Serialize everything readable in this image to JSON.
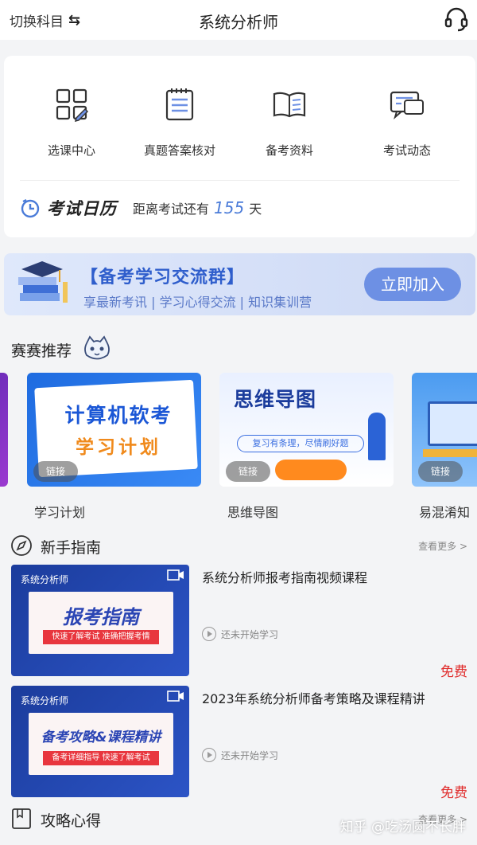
{
  "header": {
    "switch_label": "切换科目",
    "title": "系统分析师",
    "icons": [
      "switch-arrows-icon",
      "headset-icon"
    ]
  },
  "menu": {
    "items": [
      {
        "label": "选课中心",
        "icon": "course-grid-icon"
      },
      {
        "label": "真题答案核对",
        "icon": "answer-sheet-icon"
      },
      {
        "label": "备考资料",
        "icon": "open-book-icon"
      },
      {
        "label": "考试动态",
        "icon": "news-chat-icon"
      }
    ]
  },
  "calendar": {
    "title": "考试日历",
    "prefix": "距离考试还有",
    "days": "155",
    "unit": "天"
  },
  "banner": {
    "title": "【备考学习交流群】",
    "subtitle": "享最新考讯 | 学习心得交流 | 知识集训营",
    "button": "立即加入"
  },
  "recommend": {
    "title": "赛赛推荐",
    "cards": [
      {
        "label": "学习计划",
        "tag": "链接",
        "line1": "计算机软考",
        "line2": "学习计划"
      },
      {
        "label": "思维导图",
        "tag": "链接",
        "line1": "思维导图",
        "line2": "复习有条理，尽情刷好题"
      },
      {
        "label": "易混淆知",
        "tag": "链接"
      }
    ]
  },
  "guide": {
    "title": "新手指南",
    "more": "查看更多 >",
    "courses": [
      {
        "title": "系统分析师报考指南视频课程",
        "status": "还未开始学习",
        "price": "免费",
        "thumb_top": "系统分析师",
        "thumb_main": "报考指南",
        "thumb_strip": "快速了解考试 准确把握考情"
      },
      {
        "title": "2023年系统分析师备考策略及课程精讲",
        "status": "还未开始学习",
        "price": "免费",
        "thumb_top": "系统分析师",
        "thumb_main": "备考攻略&课程精讲",
        "thumb_strip": "备考详细指导 快速了解考试"
      }
    ]
  },
  "strategy": {
    "title": "攻略心得",
    "more": "查看更多 >"
  },
  "watermark": "知乎 @吃汤圆不长胖",
  "colors": {
    "accent": "#4a7bd8",
    "price": "#e02b2b",
    "banner_button": "#6d90e4"
  }
}
